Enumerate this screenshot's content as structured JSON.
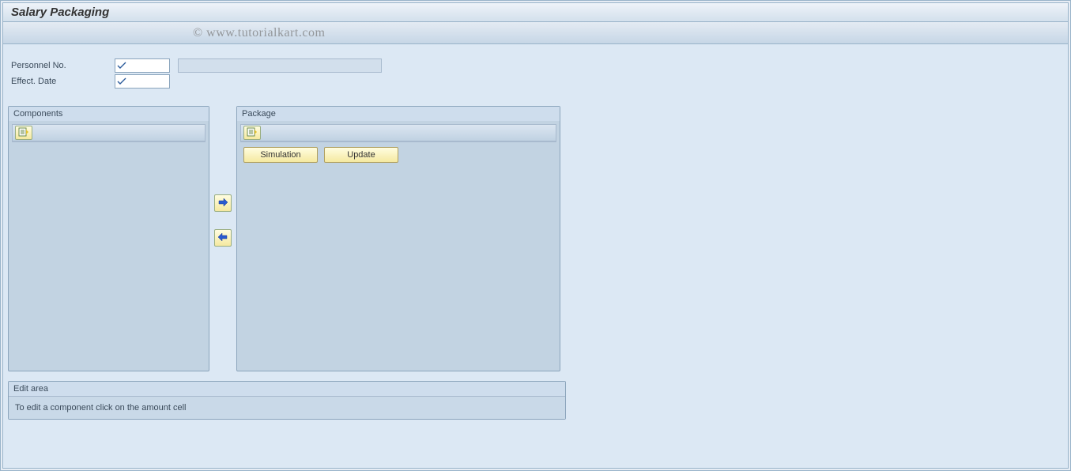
{
  "page": {
    "title": "Salary Packaging"
  },
  "watermark": "© www.tutorialkart.com",
  "fields": {
    "personnel_no_label": "Personnel No.",
    "personnel_no_value": "",
    "effect_date_label": "Effect. Date",
    "effect_date_value": ""
  },
  "panels": {
    "components_title": "Components",
    "package_title": "Package",
    "edit_area_title": "Edit area",
    "edit_area_hint": "To edit a component click on the amount cell"
  },
  "buttons": {
    "simulation": "Simulation",
    "update": "Update"
  },
  "icons": {
    "select_layout": "select-layout-icon",
    "arrow_right": "arrow-right-icon",
    "arrow_left": "arrow-left-icon",
    "check": "check-icon"
  }
}
